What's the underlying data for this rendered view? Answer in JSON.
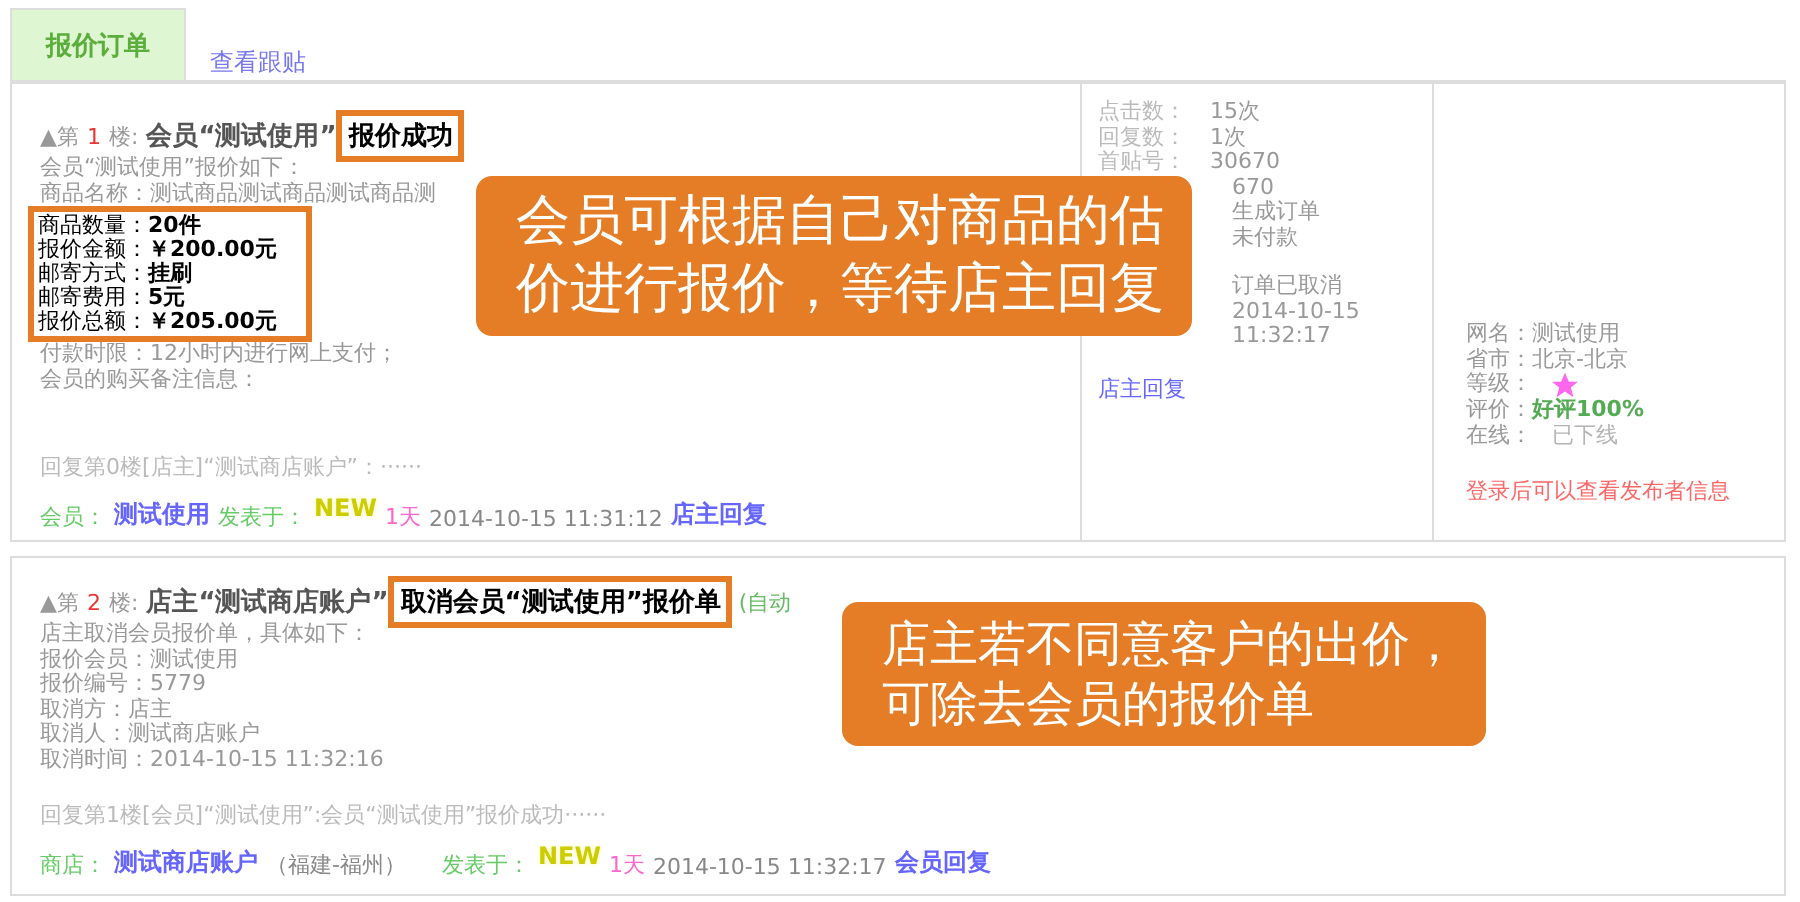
{
  "tabs": [
    {
      "label": "报价订单",
      "selected": true
    },
    {
      "label": "查看跟贴",
      "selected": false
    }
  ],
  "posts": [
    {
      "marker": "▲第",
      "floor": "1",
      "floor_suffix": "楼:",
      "title": "会员“测试使用”",
      "highlight": "报价成功",
      "intro_lines": [
        "会员“测试使用”报价如下：",
        "商品名称：测试商品测试商品测试商品测"
      ],
      "highlight_lines": [
        {
          "label": "商品数量：",
          "value": "20件"
        },
        {
          "label": "报价金额：",
          "value": "￥200.00元"
        },
        {
          "label": "邮寄方式：",
          "value": "挂刷"
        },
        {
          "label": "邮寄费用：",
          "value": "5元"
        },
        {
          "label": "报价总额：",
          "value": "￥205.00元"
        }
      ],
      "after_lines": [
        "付款时限：12小时内进行网上支付；",
        "会员的购买备注信息："
      ],
      "quote": "回复第0楼[店主]“测试商店账户”：······",
      "footer": {
        "role": "会员：",
        "name": "测试使用",
        "posted": "发表于：",
        "badge": "NEW",
        "age": "1天",
        "time": "2014-10-15 11:31:12",
        "reply": "店主回复"
      },
      "stats": [
        [
          {
            "label": "点击数：",
            "value": "15次"
          },
          {
            "label": "回复数：",
            "value": "1次"
          },
          {
            "label": "首贴号：",
            "value": "30670"
          },
          {
            "value": "670"
          },
          {
            "value": "生成订单"
          },
          {
            "value": "未付款"
          }
        ],
        [
          {
            "value": "订单已取消"
          },
          {
            "value": "2014-10-15"
          },
          {
            "value": "11:32:17"
          }
        ]
      ],
      "stats_link": "店主回复",
      "profile": [
        {
          "kind": "text",
          "label": "网名：",
          "value": "测试使用"
        },
        {
          "kind": "text",
          "label": "省市：",
          "value": "北京-北京"
        },
        {
          "kind": "star",
          "label": "等级："
        },
        {
          "kind": "rating",
          "label": "评价：",
          "value": "好评100%"
        },
        {
          "kind": "offline",
          "label": "在线：",
          "value": "已下线"
        }
      ],
      "login_note": "登录后可以查看发布者信息",
      "callout": [
        "会员可根据自己对商品的估",
        "价进行报价，等待店主回复"
      ]
    },
    {
      "marker": "▲第",
      "floor": "2",
      "floor_suffix": "楼:",
      "title": "店主“测试商店账户”",
      "highlight": "取消会员“测试使用”报价单",
      "title_note": "(自动",
      "intro_lines": [
        "店主取消会员报价单，具体如下：",
        "报价会员：测试使用",
        "报价编号：5779",
        "取消方：店主",
        "取消人：测试商店账户",
        "取消时间：2014-10-15 11:32:16"
      ],
      "quote": "回复第1楼[会员]“测试使用”:会员“测试使用”报价成功······",
      "footer": {
        "role": "商店：",
        "name": "测试商店账户",
        "location": "（福建-福州）",
        "posted": "发表于：",
        "badge": "NEW",
        "age": "1天",
        "time": "2014-10-15 11:32:17",
        "reply": "会员回复"
      },
      "callout": [
        "店主若不同意客户的出价，",
        "可除去会员的报价单"
      ]
    }
  ]
}
